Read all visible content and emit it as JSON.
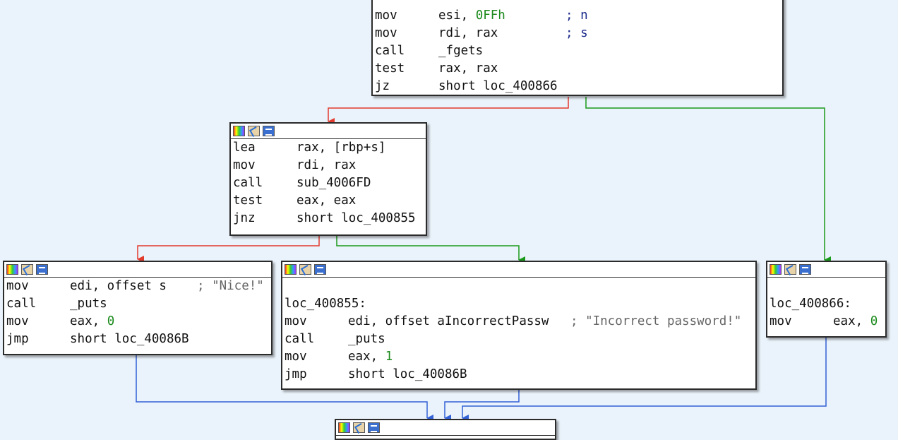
{
  "nodes": {
    "top": {
      "lines": [
        {
          "m": "mov",
          "o": "esi, ",
          "n": "0FFh",
          "c": "; n"
        },
        {
          "m": "mov",
          "o": "rdi, rax",
          "c": "; s"
        },
        {
          "m": "call",
          "o": "_fgets"
        },
        {
          "m": "test",
          "o": "rax, rax"
        },
        {
          "m": "jz",
          "o": "short loc_400866"
        }
      ]
    },
    "mid": {
      "lines": [
        {
          "m": "lea",
          "o": "rax, [rbp+s]"
        },
        {
          "m": "mov",
          "o": "rdi, rax"
        },
        {
          "m": "call",
          "o": "sub_4006FD"
        },
        {
          "m": "test",
          "o": "eax, eax"
        },
        {
          "m": "jnz",
          "o": "short loc_400855"
        }
      ]
    },
    "nice": {
      "lines": [
        {
          "m": "mov",
          "o": "edi, offset s",
          "s": "; \"Nice!\""
        },
        {
          "m": "call",
          "o": "_puts"
        },
        {
          "m": "mov",
          "o": "eax, ",
          "n": "0"
        },
        {
          "m": "jmp",
          "o": "short loc_40086B"
        }
      ]
    },
    "incorrect": {
      "lines": [
        {
          "blank": true
        },
        {
          "label": "loc_400855:"
        },
        {
          "m": "mov",
          "o": "edi, offset aIncorrectPassw",
          "s": "; \"Incorrect password!\""
        },
        {
          "m": "call",
          "o": "_puts"
        },
        {
          "m": "mov",
          "o": "eax, ",
          "n": "1"
        },
        {
          "m": "jmp",
          "o": "short loc_40086B"
        }
      ]
    },
    "right": {
      "lines": [
        {
          "blank": true
        },
        {
          "label": "loc_400866:"
        },
        {
          "m": "mov",
          "o": "eax, ",
          "n": "0"
        }
      ]
    }
  },
  "header_icons": [
    "graph-overview-icon",
    "edit-icon",
    "listing-icon"
  ],
  "colors": {
    "false_edge": "#e23b2e",
    "true_edge": "#1a9a1a",
    "flow_edge": "#3361d6",
    "number": "#1b8a1b",
    "comment": "#1a2a8a"
  },
  "watermark": ""
}
